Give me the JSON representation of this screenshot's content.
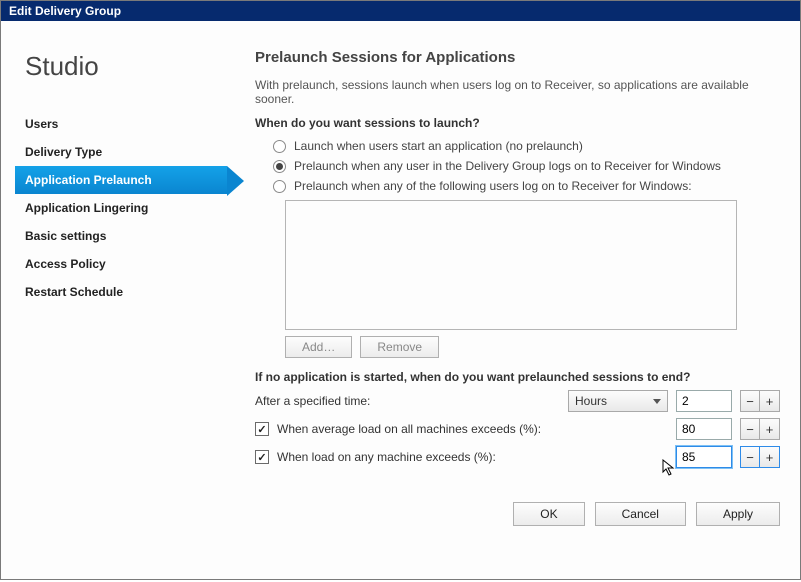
{
  "window": {
    "title": "Edit Delivery Group"
  },
  "brand": "Studio",
  "sidebar": {
    "items": [
      {
        "label": "Users"
      },
      {
        "label": "Delivery Type"
      },
      {
        "label": "Application Prelaunch"
      },
      {
        "label": "Application Lingering"
      },
      {
        "label": "Basic settings"
      },
      {
        "label": "Access Policy"
      },
      {
        "label": "Restart Schedule"
      }
    ],
    "selected_index": 2
  },
  "main": {
    "heading": "Prelaunch Sessions for Applications",
    "description": "With prelaunch, sessions launch when users log on to Receiver, so applications are available sooner.",
    "question1": "When do you want sessions to launch?",
    "radios": [
      {
        "label": "Launch when users start an application (no prelaunch)"
      },
      {
        "label": "Prelaunch when any user in the Delivery Group logs on to Receiver for Windows"
      },
      {
        "label": "Prelaunch when any of the following users log on to Receiver for Windows:"
      }
    ],
    "radio_selected": 1,
    "list_buttons": {
      "add": "Add…",
      "remove": "Remove"
    },
    "question2": "If no application is started, when do you want prelaunched sessions to end?",
    "after_time": {
      "label": "After a specified time:",
      "unit_options": [
        "Hours"
      ],
      "unit_selected": "Hours",
      "value": "2"
    },
    "avg_load": {
      "label": "When average load on all machines exceeds (%):",
      "checked": true,
      "value": "80"
    },
    "any_load": {
      "label": "When load on any machine exceeds (%):",
      "checked": true,
      "value": "85"
    }
  },
  "footer": {
    "ok": "OK",
    "cancel": "Cancel",
    "apply": "Apply"
  }
}
